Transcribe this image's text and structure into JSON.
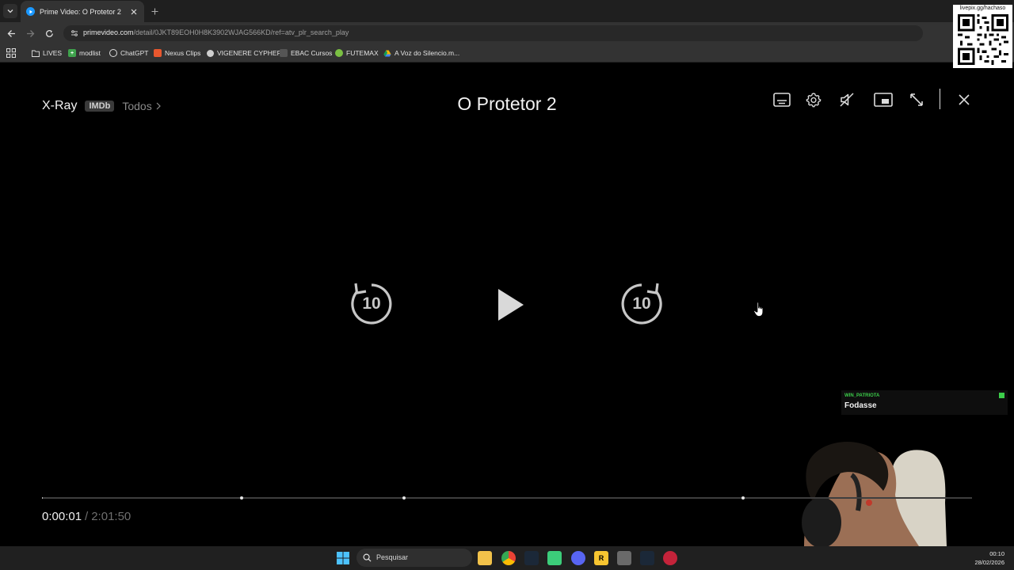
{
  "browser": {
    "tab_title": "Prime Video: O Protetor 2",
    "url_host": "primevideo.com",
    "url_path": "/detail/0JKT89EOH0H8K3902WJAG566KD/ref=atv_plr_search_play",
    "bookmarks": [
      "LIVES",
      "modlist",
      "ChatGPT",
      "Nexus Clips",
      "VIGENERE CYPHER",
      "EBAC Cursos",
      "FUTEMAX",
      "A Voz do Silencio.m..."
    ]
  },
  "overlay": {
    "qr_caption": "livepix.gg/hachaso",
    "chat_user": "WIN_PATRIOTA",
    "chat_message": "Fodasse"
  },
  "player": {
    "xray_label": "X-Ray",
    "imdb_label": "IMDb",
    "todos_label": "Todos",
    "title": "O Protetor 2",
    "rewind_seconds": "10",
    "forward_seconds": "10",
    "current_time": "0:00:01",
    "separator": "/",
    "total_time": "2:01:50",
    "progress_fraction": 0.0001
  },
  "taskbar": {
    "search_placeholder": "Pesquisar",
    "time": "00:10",
    "date": "28/02/2026"
  },
  "colors": {
    "player_bg": "#000000",
    "chat_accent": "#3ccd4a",
    "prime_blue": "#1a98ff"
  }
}
